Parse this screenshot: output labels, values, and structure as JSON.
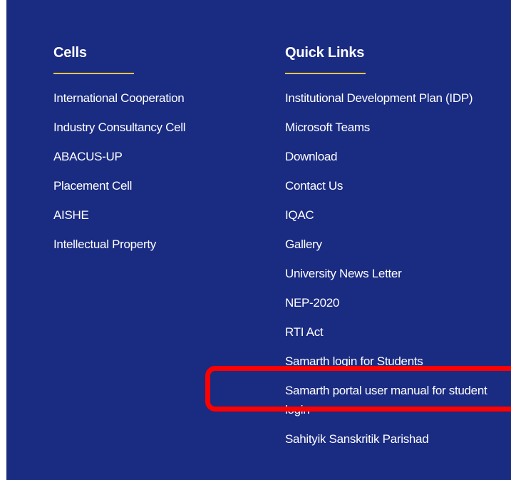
{
  "cells": {
    "heading": "Cells",
    "links": [
      "International Cooperation",
      "Industry Consultancy Cell",
      "ABACUS-UP",
      "Placement Cell",
      "AISHE",
      "Intellectual Property"
    ]
  },
  "quick_links": {
    "heading": "Quick Links",
    "links": [
      "Institutional Development Plan (IDP)",
      "Microsoft Teams",
      "Download",
      "Contact Us",
      "IQAC",
      "Gallery",
      "University News Letter",
      "NEP-2020",
      "RTI Act",
      "Samarth login for Students",
      "Samarth portal user manual for student login",
      "Sahityik Sanskritik Parishad"
    ]
  },
  "colors": {
    "background": "#1a2b82",
    "accent_underline": "#f5c542",
    "highlight": "#ff0000",
    "text": "#ffffff"
  }
}
